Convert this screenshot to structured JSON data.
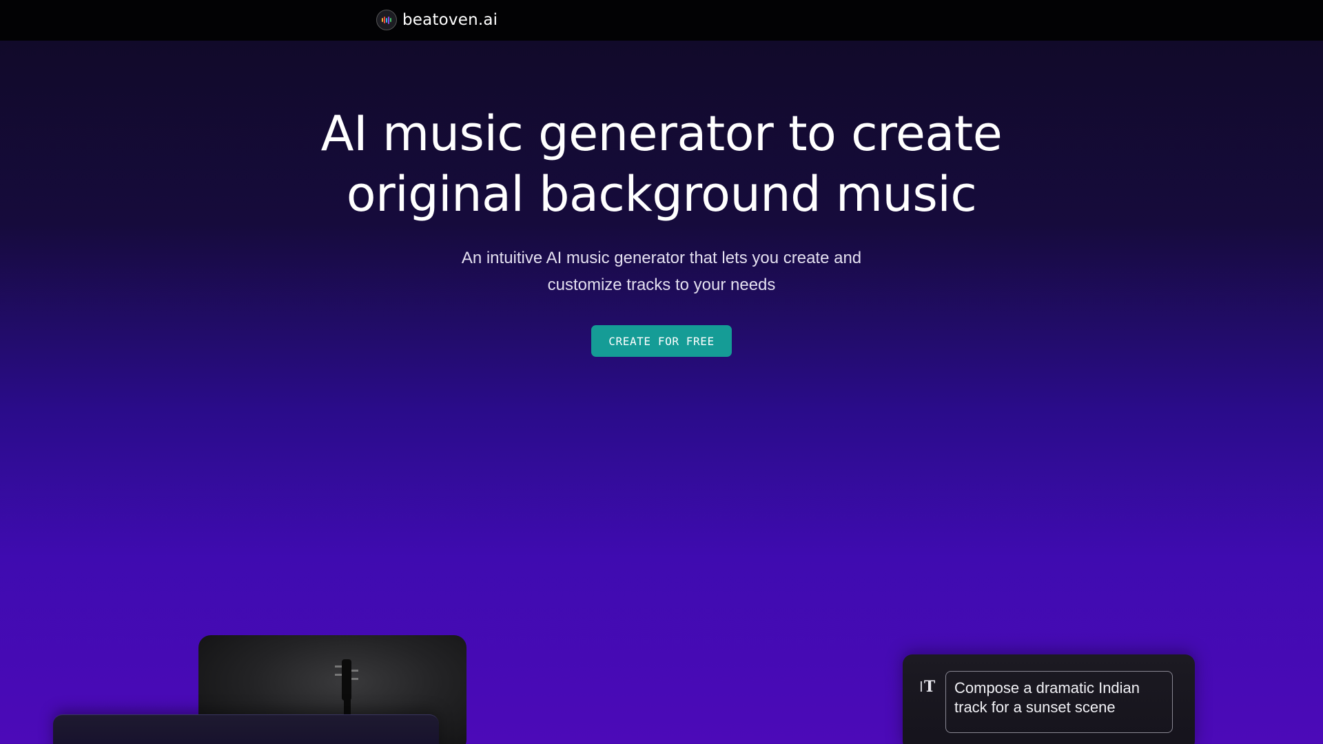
{
  "header": {
    "brand_name": "beatoven.ai",
    "logo_icon": "beatoven-logo-icon"
  },
  "hero": {
    "title_line1": "AI music generator to create",
    "title_line2": "original background music",
    "subtitle_line1": "An intuitive AI music generator that lets you create and",
    "subtitle_line2": "customize tracks to your needs",
    "cta_label": "CREATE FOR FREE"
  },
  "prompt_card": {
    "icon": "text-tool-icon",
    "prompt_text_line1": "Compose a dramatic Indian",
    "prompt_text_line2": "track for a sunset scene"
  },
  "colors": {
    "accent": "#159c96",
    "topbar": "#020204",
    "gradient_top": "#100a26",
    "gradient_bottom": "#4c0ab8"
  }
}
